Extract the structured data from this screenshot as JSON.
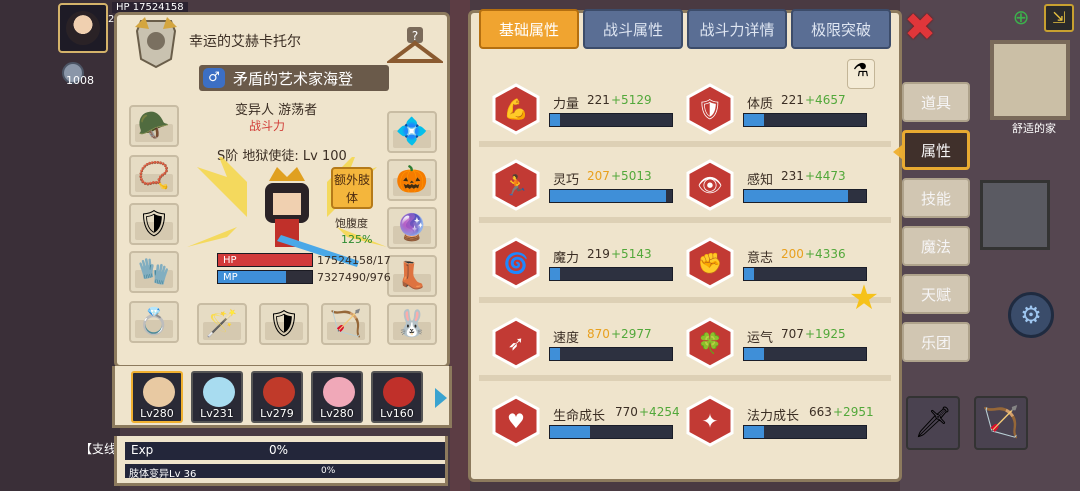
{
  "hud": {
    "hp_text": "HP 17524158",
    "level_text": "2",
    "coin_count": "1008",
    "side_label": "【支线"
  },
  "character": {
    "owner_name": "幸运的艾赫卡托尔",
    "title": "矛盾的艺术家海登",
    "gender_symbol": "♂",
    "race": "变异人 游荡者",
    "power_label": "战斗力",
    "rank": "S阶 地狱使徒: Lv 100",
    "extra_button": "额外肢体",
    "hunger_label": "饱腹度",
    "hunger_value": "125%",
    "hp_label": "HP",
    "hp_value": "17524158/17",
    "hp_fill_fraction": 1.0,
    "mp_label": "MP",
    "mp_value": "7327490/976",
    "mp_fill_fraction": 0.72
  },
  "pets": [
    {
      "level": "Lv280",
      "color": "#e8c9a2"
    },
    {
      "level": "Lv231",
      "color": "#a8dcf0"
    },
    {
      "level": "Lv279",
      "color": "#c03a2a"
    },
    {
      "level": "Lv280",
      "color": "#f0a8b8"
    },
    {
      "level": "Lv160",
      "color": "#c0302a"
    }
  ],
  "exp": {
    "label": "Exp",
    "percent": "0%",
    "sub_label": "肢体变异Lv 36",
    "sub_percent": "0%"
  },
  "tabs": [
    "基础属性",
    "战斗属性",
    "战斗力详情",
    "极限突破"
  ],
  "active_tab": 0,
  "stats": [
    {
      "name": "力量",
      "base": "221",
      "bonus": "+5129",
      "highlight": false,
      "fill": 0.08,
      "icon": "strength-icon"
    },
    {
      "name": "体质",
      "base": "221",
      "bonus": "+4657",
      "highlight": false,
      "fill": 0.16,
      "icon": "constitution-icon"
    },
    {
      "name": "灵巧",
      "base": "207",
      "bonus": "+5013",
      "highlight": true,
      "fill": 0.95,
      "icon": "agility-icon"
    },
    {
      "name": "感知",
      "base": "231",
      "bonus": "+4473",
      "highlight": false,
      "fill": 0.85,
      "icon": "perception-icon"
    },
    {
      "name": "魔力",
      "base": "219",
      "bonus": "+5143",
      "highlight": false,
      "fill": 0.08,
      "icon": "magic-icon"
    },
    {
      "name": "意志",
      "base": "200",
      "bonus": "+4336",
      "highlight": true,
      "fill": 0.08,
      "icon": "will-icon"
    },
    {
      "name": "速度",
      "base": "870",
      "bonus": "+2977",
      "highlight": true,
      "fill": 0.08,
      "icon": "speed-icon"
    },
    {
      "name": "运气",
      "base": "707",
      "bonus": "+1925",
      "highlight": false,
      "fill": 0.16,
      "icon": "luck-icon"
    },
    {
      "name": "生命成长",
      "base": "770",
      "bonus": "+4254",
      "highlight": false,
      "fill": 0.33,
      "icon": "life-growth-icon"
    },
    {
      "name": "法力成长",
      "base": "663",
      "bonus": "+2951",
      "highlight": false,
      "fill": 0.16,
      "icon": "mana-growth-icon"
    }
  ],
  "side_menu": [
    "道具",
    "属性",
    "技能",
    "魔法",
    "天赋",
    "乐团"
  ],
  "side_active": 1,
  "home_label": "舒适的家",
  "colors": {
    "tab_active": "#f0a430",
    "tab_inactive": "#5a6e94",
    "stat_bar": "#3f8fd8",
    "bonus_green": "#52a83a",
    "highlight_orange": "#e8a01e",
    "close_red": "#e0363a"
  }
}
